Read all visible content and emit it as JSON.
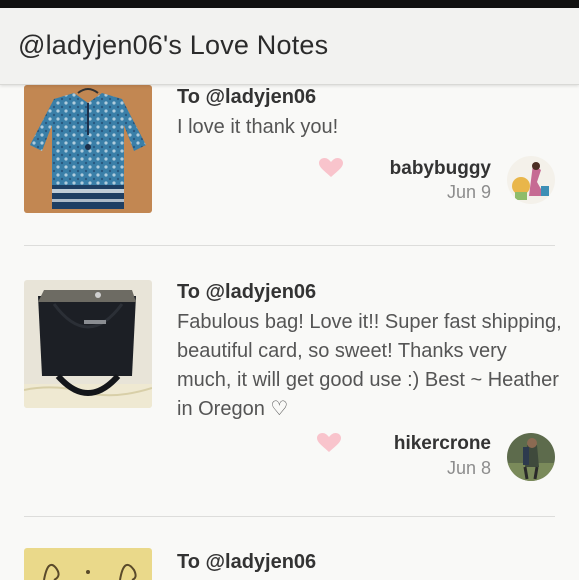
{
  "header": {
    "title": "@ladyjen06's Love Notes"
  },
  "notes": [
    {
      "to": "To @ladyjen06",
      "message": "I love it thank you!",
      "username": "babybuggy",
      "date": "Jun 9"
    },
    {
      "to": "To @ladyjen06",
      "message": "Fabulous bag! Love it!! Super fast shipping, beautiful card, so sweet! Thanks very much, it will get good use :) Best ~ Heather in Oregon ♡",
      "username": "hikercrone",
      "date": "Jun 8"
    },
    {
      "to": "To @ladyjen06"
    }
  ],
  "colors": {
    "heart": "#f9c4cc",
    "divider": "#dddddb",
    "header_bg": "#f2f2f0"
  }
}
